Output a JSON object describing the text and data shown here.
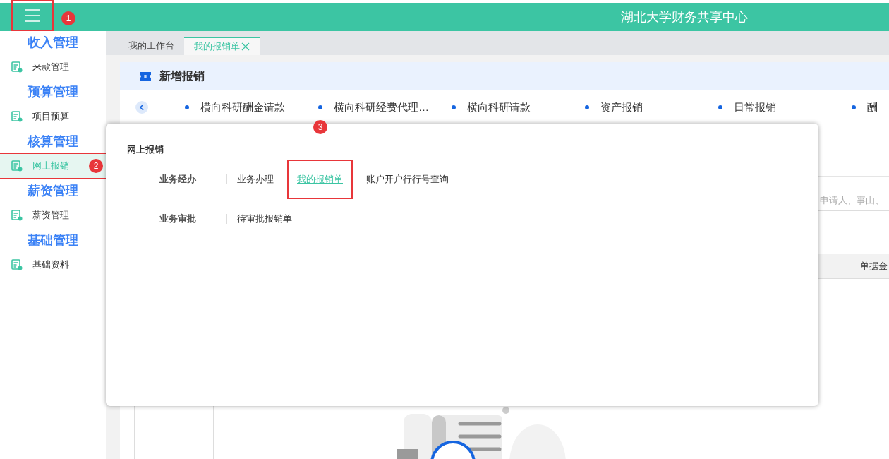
{
  "header": {
    "title": "湖北大学财务共享中心",
    "menu_highlighted": true,
    "callout": "1"
  },
  "sidebar": {
    "groups": [
      {
        "title": "收入管理",
        "items": [
          {
            "label": "来款管理",
            "selected": false
          }
        ]
      },
      {
        "title": "预算管理",
        "items": [
          {
            "label": "项目预算",
            "selected": false
          }
        ]
      },
      {
        "title": "核算管理",
        "items": [
          {
            "label": "网上报销",
            "selected": true,
            "highlighted": true,
            "callout": "2"
          }
        ]
      },
      {
        "title": "薪资管理",
        "items": [
          {
            "label": "薪资管理",
            "selected": false
          }
        ]
      },
      {
        "title": "基础管理",
        "items": [
          {
            "label": "基础资料",
            "selected": false
          }
        ]
      }
    ]
  },
  "tabs": [
    {
      "label": "我的工作台",
      "selected": false,
      "closable": false
    },
    {
      "label": "我的报销单",
      "selected": true,
      "closable": true
    }
  ],
  "new_claim": {
    "title": "新增报销",
    "categories": [
      "横向科研酬金请款",
      "横向科研经费代理…",
      "横向科研请款",
      "资产报销",
      "日常报销",
      "酬"
    ]
  },
  "search": {
    "placeholder": "申请人、事由、"
  },
  "table": {
    "columns": [
      "单据金"
    ]
  },
  "menu_panel": {
    "title": "网上报销",
    "sections": [
      {
        "label": "业务经办",
        "links": [
          {
            "label": "业务办理",
            "selected": false
          },
          {
            "label": "我的报销单",
            "selected": true,
            "highlighted": true,
            "callout": "3"
          },
          {
            "label": "账户开户行行号查询",
            "selected": false
          }
        ]
      },
      {
        "label": "业务审批",
        "links": [
          {
            "label": "待审批报销单",
            "selected": false
          }
        ]
      }
    ]
  }
}
